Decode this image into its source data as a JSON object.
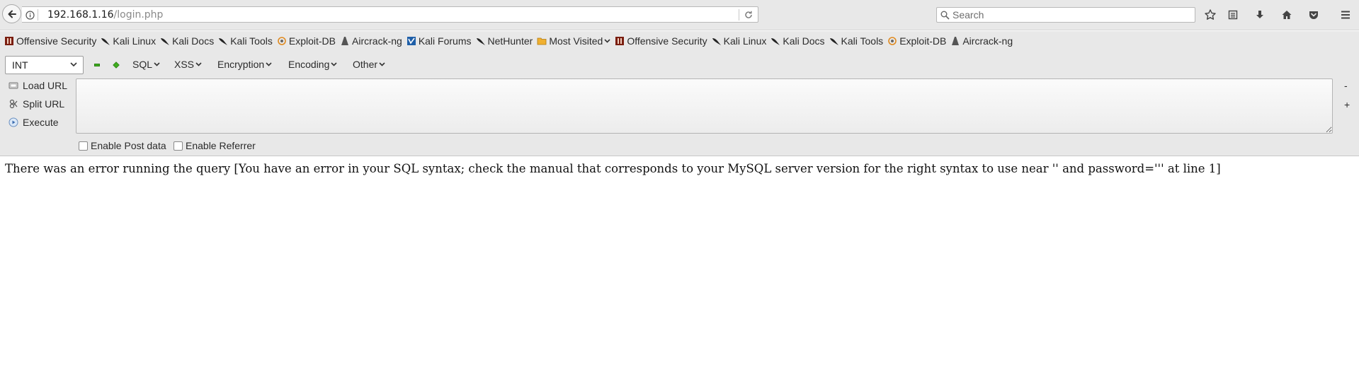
{
  "browser": {
    "url_host": "192.168.1.16",
    "url_path": "/login.php",
    "search_placeholder": "Search",
    "icons": [
      "back-arrow-icon",
      "info-icon",
      "reload-icon",
      "search-icon",
      "star-icon",
      "reading-list-icon",
      "download-icon",
      "home-icon",
      "pocket-icon",
      "hamburger-menu-icon"
    ]
  },
  "bookmarks": [
    {
      "label": "Offensive Security",
      "icon": "offsec-icon"
    },
    {
      "label": "Kali Linux",
      "icon": "kali-dragon-icon"
    },
    {
      "label": "Kali Docs",
      "icon": "kali-dragon-icon"
    },
    {
      "label": "Kali Tools",
      "icon": "kali-dragon-icon"
    },
    {
      "label": "Exploit-DB",
      "icon": "exploit-db-icon"
    },
    {
      "label": "Aircrack-ng",
      "icon": "aircrack-icon"
    },
    {
      "label": "Kali Forums",
      "icon": "kali-forums-icon"
    },
    {
      "label": "NetHunter",
      "icon": "kali-dragon-icon"
    },
    {
      "label": "Most Visited",
      "icon": "most-visited-folder-icon"
    },
    {
      "label": "Offensive Security",
      "icon": "offsec-icon"
    },
    {
      "label": "Kali Linux",
      "icon": "kali-dragon-icon"
    },
    {
      "label": "Kali Docs",
      "icon": "kali-dragon-icon"
    },
    {
      "label": "Kali Tools",
      "icon": "kali-dragon-icon"
    },
    {
      "label": "Exploit-DB",
      "icon": "exploit-db-icon"
    },
    {
      "label": "Aircrack-ng",
      "icon": "aircrack-icon"
    }
  ],
  "hackbar": {
    "type_select": "INT",
    "menus": [
      "SQL",
      "XSS",
      "Encryption",
      "Encoding",
      "Other"
    ],
    "actions": [
      {
        "label": "Load URL",
        "icon": "load-url-icon"
      },
      {
        "label": "Split URL",
        "icon": "split-url-icon"
      },
      {
        "label": "Execute",
        "icon": "execute-icon"
      }
    ],
    "textarea_value": "",
    "minus_label": "-",
    "plus_label": "+",
    "enable_post_label": "Enable Post data",
    "enable_referrer_label": "Enable Referrer"
  },
  "page": {
    "error_message": "There was an error running the query [You have an error in your SQL syntax; check the manual that corresponds to your MySQL server version for the right syntax to use near '' and password=''' at line 1]"
  },
  "colors": {
    "chrome_bg": "#e8e8e8",
    "hackbar_green": "#3fae1f",
    "page_bg": "#ffffff"
  }
}
